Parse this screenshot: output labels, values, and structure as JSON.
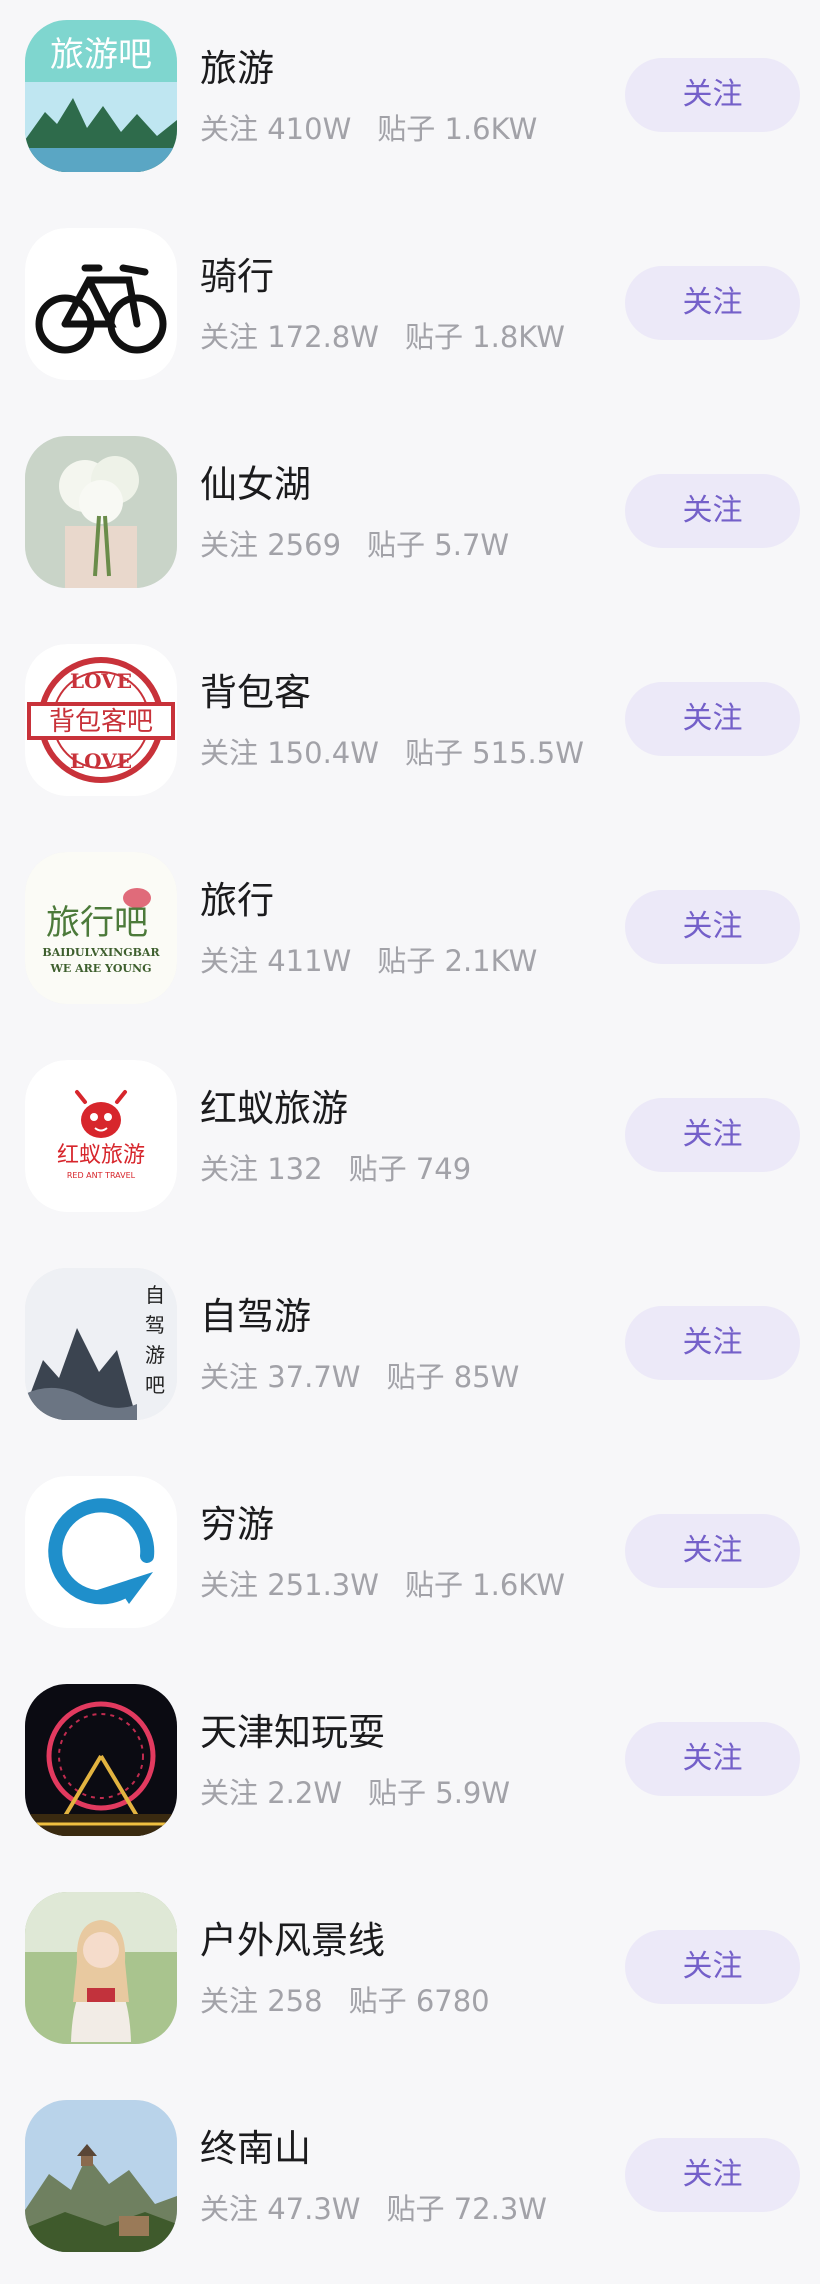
{
  "forums": [
    {
      "name": "旅游",
      "follow_label": "关注",
      "follows_prefix": "关注",
      "follows": "410W",
      "posts_prefix": "贴子",
      "posts": "1.6KW",
      "logo_text": "旅游吧"
    },
    {
      "name": "骑行",
      "follow_label": "关注",
      "follows_prefix": "关注",
      "follows": "172.8W",
      "posts_prefix": "贴子",
      "posts": "1.8KW"
    },
    {
      "name": "仙女湖",
      "follow_label": "关注",
      "follows_prefix": "关注",
      "follows": "2569",
      "posts_prefix": "贴子",
      "posts": "5.7W"
    },
    {
      "name": "背包客",
      "follow_label": "关注",
      "follows_prefix": "关注",
      "follows": "150.4W",
      "posts_prefix": "贴子",
      "posts": "515.5W",
      "logo_top": "LOVE",
      "logo_mid": "背包客吧",
      "logo_bottom": "LOVE"
    },
    {
      "name": "旅行",
      "follow_label": "关注",
      "follows_prefix": "关注",
      "follows": "411W",
      "posts_prefix": "贴子",
      "posts": "2.1KW",
      "logo_text": "旅行吧",
      "logo_line1": "BAIDULVXINGBAR",
      "logo_line2": "WE ARE YOUNG"
    },
    {
      "name": "红蚁旅游",
      "follow_label": "关注",
      "follows_prefix": "关注",
      "follows": "132",
      "posts_prefix": "贴子",
      "posts": "749",
      "logo_text": "红蚁旅游",
      "logo_sub": "RED ANT TRAVEL"
    },
    {
      "name": "自驾游",
      "follow_label": "关注",
      "follows_prefix": "关注",
      "follows": "37.7W",
      "posts_prefix": "贴子",
      "posts": "85W",
      "logo_text": "自驾游吧"
    },
    {
      "name": "穷游",
      "follow_label": "关注",
      "follows_prefix": "关注",
      "follows": "251.3W",
      "posts_prefix": "贴子",
      "posts": "1.6KW"
    },
    {
      "name": "天津知玩耍",
      "follow_label": "关注",
      "follows_prefix": "关注",
      "follows": "2.2W",
      "posts_prefix": "贴子",
      "posts": "5.9W"
    },
    {
      "name": "户外风景线",
      "follow_label": "关注",
      "follows_prefix": "关注",
      "follows": "258",
      "posts_prefix": "贴子",
      "posts": "6780"
    },
    {
      "name": "终南山",
      "follow_label": "关注",
      "follows_prefix": "关注",
      "follows": "47.3W",
      "posts_prefix": "贴子",
      "posts": "72.3W"
    }
  ],
  "colors": {
    "background": "#f7f7f9",
    "button_bg": "#ece9f8",
    "button_text": "#7460c9",
    "title": "#1b1b1d",
    "meta": "#a2a2a8"
  }
}
